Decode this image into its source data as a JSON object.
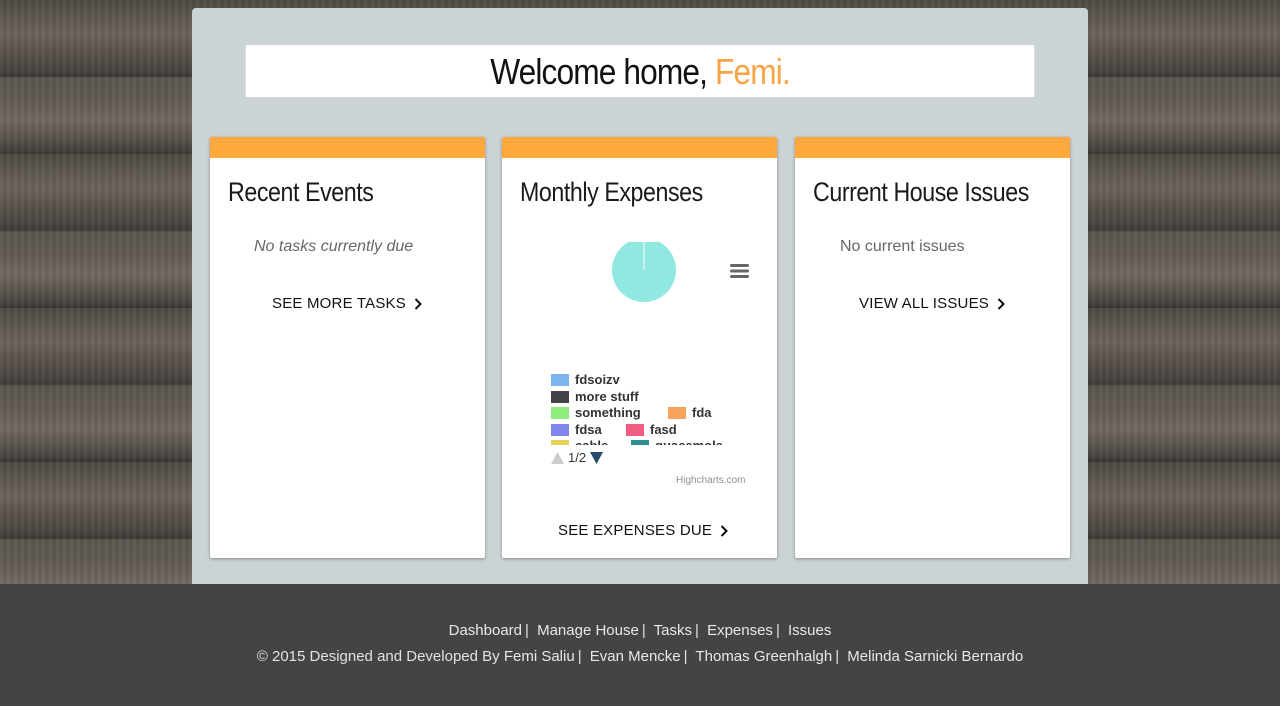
{
  "welcome": {
    "prefix": "Welcome home, ",
    "name": "Femi."
  },
  "cards": {
    "events": {
      "title": "Recent Events",
      "message": "No tasks currently due",
      "link": "SEE MORE TASKS"
    },
    "expenses": {
      "title": "Monthly Expenses",
      "link": "SEE EXPENSES DUE",
      "credit": "Highcharts.com",
      "pager": "1/2"
    },
    "issues": {
      "title": "Current House Issues",
      "message": "No current issues",
      "link": "VIEW ALL ISSUES"
    }
  },
  "chart_data": {
    "type": "pie",
    "slices": [
      {
        "name": "fdsoizv",
        "color": "#7cb5ec"
      },
      {
        "name": "more stuff",
        "color": "#434348"
      },
      {
        "name": "something",
        "color": "#90ed7d"
      },
      {
        "name": "fda",
        "color": "#f7a35c"
      },
      {
        "name": "fdsa",
        "color": "#8085e9"
      },
      {
        "name": "fasd",
        "color": "#f15c80"
      },
      {
        "name": "cable",
        "color": "#e4d354"
      },
      {
        "name": "guacamole",
        "color": "#2b908f"
      }
    ],
    "pie_color": "#91e8e1",
    "legend_page": "1/2",
    "menu_icon": "hamburger-icon"
  },
  "footer": {
    "nav": [
      "Dashboard",
      "Manage House",
      "Tasks",
      "Expenses",
      "Issues"
    ],
    "copyright": "© 2015 Designed and Developed By",
    "authors": [
      "Femi Saliu",
      "Evan Mencke",
      "Thomas Greenhalgh",
      "Melinda Sarnicki Bernardo"
    ]
  }
}
